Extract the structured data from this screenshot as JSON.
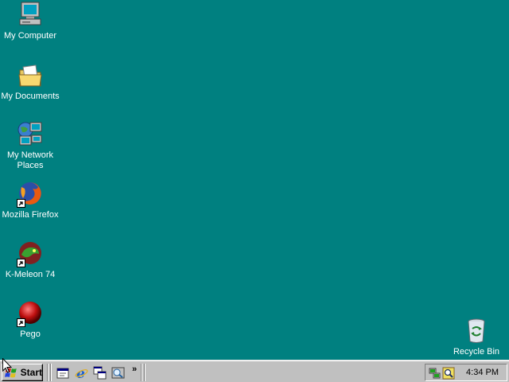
{
  "desktop": {
    "background_color": "#008080",
    "icons": [
      {
        "label": "My Computer",
        "icon": "my-computer-icon"
      },
      {
        "label": "My Documents",
        "icon": "my-documents-icon"
      },
      {
        "label": "My Network Places",
        "icon": "network-places-icon"
      },
      {
        "label": "Mozilla Firefox",
        "icon": "firefox-icon"
      },
      {
        "label": "K-Meleon 74",
        "icon": "k-meleon-icon"
      },
      {
        "label": "Pego",
        "icon": "pego-icon"
      },
      {
        "label": "Recycle Bin",
        "icon": "recycle-bin-icon"
      }
    ]
  },
  "taskbar": {
    "start_label": "Start",
    "quick_launch": [
      {
        "icon": "show-desktop-icon"
      },
      {
        "icon": "internet-explorer-icon"
      },
      {
        "icon": "window-switch-icon"
      },
      {
        "icon": "media-icon"
      }
    ],
    "overflow_label": "»",
    "tray": {
      "icons": [
        "network-tray-icon",
        "search-tray-icon"
      ],
      "clock": "4:34 PM"
    }
  }
}
